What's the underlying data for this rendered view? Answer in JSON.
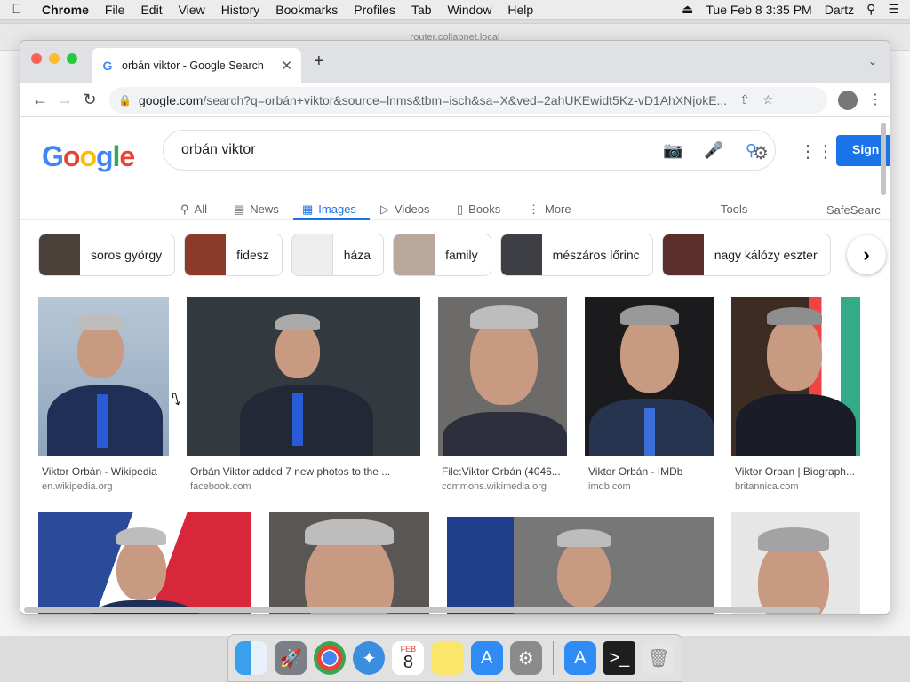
{
  "menubar": {
    "app": "Chrome",
    "items": [
      "File",
      "Edit",
      "View",
      "History",
      "Bookmarks",
      "Profiles",
      "Tab",
      "Window",
      "Help"
    ],
    "datetime": "Tue Feb 8  3:35 PM",
    "user": "Dartz"
  },
  "background_window": {
    "title": "router.collabnet.local"
  },
  "tab": {
    "title": "orbán viktor - Google Search",
    "favicon": "G"
  },
  "omnibox": {
    "host": "google.com",
    "path": "/search?q=orbán+viktor&source=lnms&tbm=isch&sa=X&ved=2ahUKEwidt5Kz-vD1AhXNjokE..."
  },
  "search": {
    "query": "orbán viktor",
    "signin_label": "Sign"
  },
  "nav_tabs": {
    "all": "All",
    "news": "News",
    "images": "Images",
    "videos": "Videos",
    "books": "Books",
    "more": "More",
    "tools": "Tools",
    "safesearch": "SafeSearc"
  },
  "chips": [
    "soros györgy",
    "fidesz",
    "háza",
    "family",
    "mészáros lőrinc",
    "nagy kálózy eszter"
  ],
  "results_row1": [
    {
      "title": "Viktor Orbán - Wikipedia",
      "source": "en.wikipedia.org"
    },
    {
      "title": "Orbán Viktor added 7 new photos to the ...",
      "source": "facebook.com"
    },
    {
      "title": "File:Viktor Orbán (4046...",
      "source": "commons.wikimedia.org"
    },
    {
      "title": "Viktor Orbán - IMDb",
      "source": "imdb.com"
    },
    {
      "title": "Viktor Orban | Biograph...",
      "source": "britannica.com"
    }
  ],
  "dock": {
    "calendar_month": "FEB",
    "calendar_day": "8"
  }
}
